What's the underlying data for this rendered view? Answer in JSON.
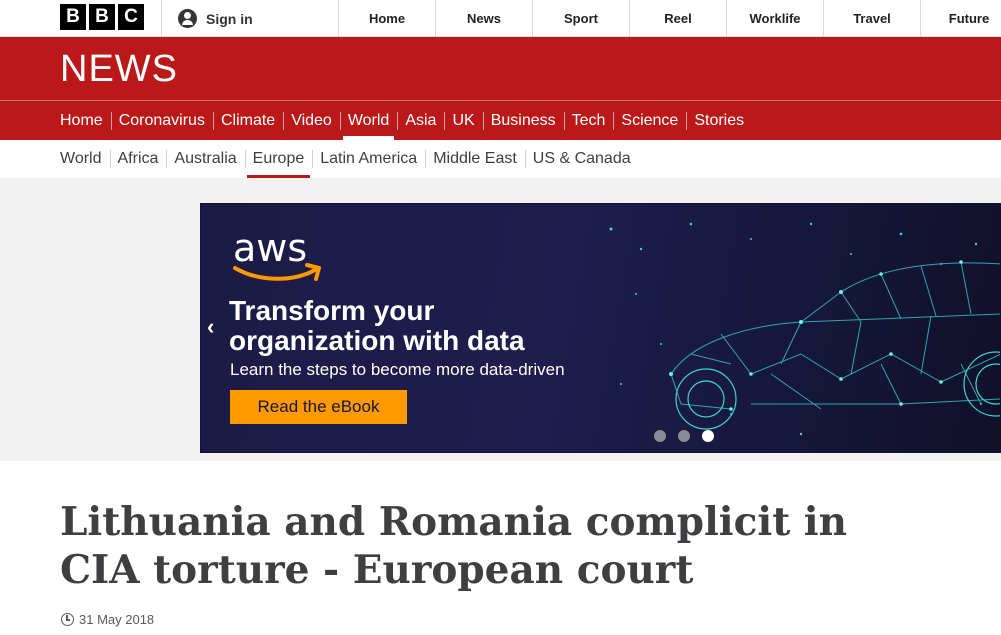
{
  "logo": {
    "letters": [
      "B",
      "B",
      "C"
    ]
  },
  "account": {
    "signin_label": "Sign in"
  },
  "top_nav": [
    "Home",
    "News",
    "Sport",
    "Reel",
    "Worklife",
    "Travel",
    "Future"
  ],
  "section": {
    "title": "NEWS"
  },
  "main_nav": {
    "items": [
      "Home",
      "Coronavirus",
      "Climate",
      "Video",
      "World",
      "Asia",
      "UK",
      "Business",
      "Tech",
      "Science",
      "Stories"
    ],
    "active": "World"
  },
  "sub_nav": {
    "items": [
      "World",
      "Africa",
      "Australia",
      "Europe",
      "Latin America",
      "Middle East",
      "US & Canada"
    ],
    "active": "Europe"
  },
  "ad": {
    "brand": "aws",
    "headline_line1": "Transform your",
    "headline_line2": "organization with data",
    "subtext": "Learn the steps to become more data-driven",
    "cta": "Read the eBook",
    "slides_total": 3,
    "active_slide": 3,
    "accent_color": "#ff9900"
  },
  "article": {
    "title_line1": "Lithuania and Romania complicit in",
    "title_line2": "CIA torture - European court",
    "date": "31 May 2018"
  },
  "colors": {
    "brand_red": "#bb1919"
  }
}
